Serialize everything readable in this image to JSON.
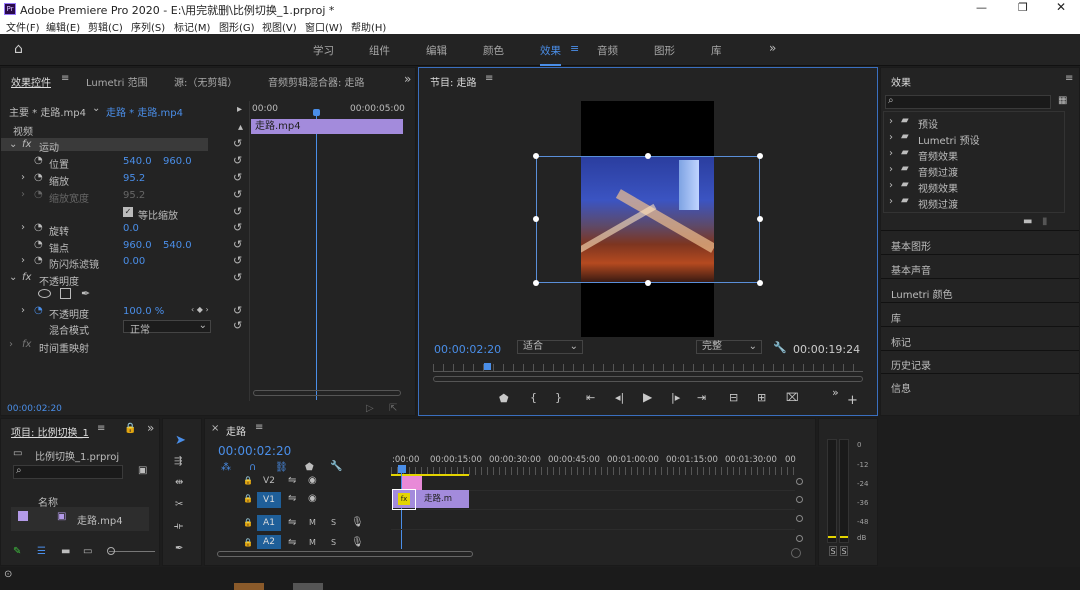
{
  "window": {
    "title": "Adobe Premiere Pro 2020 - E:\\用完就删\\比例切换_1.prproj *"
  },
  "menu": [
    "文件(F)",
    "编辑(E)",
    "剪辑(C)",
    "序列(S)",
    "标记(M)",
    "图形(G)",
    "视图(V)",
    "窗口(W)",
    "帮助(H)"
  ],
  "workspaces": [
    "学习",
    "组件",
    "编辑",
    "颜色",
    "效果",
    "音频",
    "图形",
    "库"
  ],
  "effect_controls": {
    "tabs": [
      "效果控件",
      "Lumetri 范围",
      "源:（无剪辑）",
      "音频剪辑混合器: 走路"
    ],
    "source_clip": "主要 * 走路.mp4",
    "seq_clip": "走路 * 走路.mp4",
    "section": "视频",
    "ruler": [
      "00:00",
      "00:00:05:00"
    ],
    "clip_name": "走路.mp4",
    "motion": "运动",
    "position": "位置",
    "pos_x": "540.0",
    "pos_y": "960.0",
    "scale": "缩放",
    "scale_val": "95.2",
    "scale_w": "缩放宽度",
    "scale_w_val": "95.2",
    "uniform": "等比缩放",
    "rotation": "旋转",
    "rotation_val": "0.0",
    "anchor": "锚点",
    "anchor_x": "960.0",
    "anchor_y": "540.0",
    "flicker": "防闪烁滤镜",
    "flicker_val": "0.00",
    "opacity": "不透明度",
    "opacity_val": "100.0 %",
    "blend": "混合模式",
    "blend_val": "正常",
    "timeremap": "时间重映射",
    "time": "00:00:02:20"
  },
  "program": {
    "title": "节目: 走路",
    "timecode": "00:00:02:20",
    "fit": "适合",
    "quality": "完整",
    "duration": "00:00:19:24"
  },
  "effects": {
    "title": "效果",
    "folders": [
      "预设",
      "Lumetri 预设",
      "音频效果",
      "音频过渡",
      "视频效果",
      "视频过渡"
    ],
    "panels": [
      "基本图形",
      "基本声音",
      "Lumetri 颜色",
      "库",
      "标记",
      "历史记录",
      "信息"
    ]
  },
  "project": {
    "title": "项目: 比例切换_1",
    "file": "比例切换_1.prproj",
    "col_name": "名称",
    "item": "走路.mp4"
  },
  "timeline": {
    "title": "走路",
    "timecode": "00:00:02:20",
    "ruler": [
      ":00:00",
      "00:00:15:00",
      "00:00:30:00",
      "00:00:45:00",
      "00:01:00:00",
      "00:01:15:00",
      "00:01:30:00",
      "00"
    ],
    "tracks": [
      "V2",
      "V1",
      "A1",
      "A2"
    ],
    "clip": "走路.m",
    "m": "M",
    "s": "S"
  },
  "meter": {
    "scale": [
      "0",
      "-12",
      "-24",
      "-36",
      "-48",
      "dB"
    ],
    "s": "S"
  }
}
